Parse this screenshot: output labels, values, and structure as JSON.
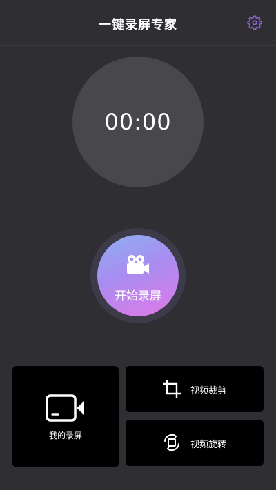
{
  "header": {
    "title": "一键录屏专家",
    "settings_icon": "gear-icon"
  },
  "timer": {
    "time": "00:00"
  },
  "record_button": {
    "label": "开始录屏",
    "icon": "video-camera-icon"
  },
  "tiles": {
    "my_recordings": {
      "label": "我的录屏",
      "icon": "video-icon"
    },
    "video_crop": {
      "label": "视频裁剪",
      "icon": "crop-icon"
    },
    "video_rotate": {
      "label": "视频旋转",
      "icon": "rotate-icon"
    }
  },
  "colors": {
    "background": "#2f2e33",
    "accent": "#8a63d2",
    "timer_circle": "#48474c",
    "tile_background": "#000000",
    "gradient_start": "#8db0f2",
    "gradient_end": "#e07ae8"
  }
}
